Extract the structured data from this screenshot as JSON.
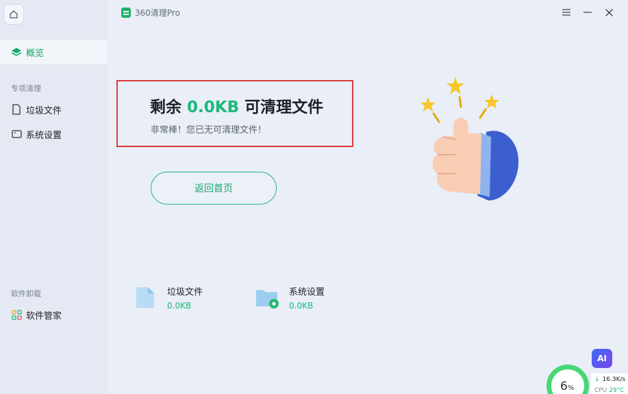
{
  "app": {
    "title": "360清理Pro"
  },
  "sidebar": {
    "overview": "概览",
    "section_special": "专项清理",
    "items": [
      {
        "label": "垃圾文件"
      },
      {
        "label": "系统设置"
      }
    ],
    "section_uninstall": "软件卸载",
    "software_manager": "软件管家"
  },
  "result": {
    "prefix": "剩余",
    "amount": "0.0KB",
    "suffix": "可清理文件",
    "subtitle": "非常棒！您已无可清理文件！",
    "back_button": "返回首页"
  },
  "summary": [
    {
      "name": "垃圾文件",
      "size": "0.0KB"
    },
    {
      "name": "系统设置",
      "size": "0.0KB"
    }
  ],
  "widget": {
    "ai_label": "AI",
    "percent": "6",
    "percent_unit": "%",
    "net_speed": "16.3K/s",
    "cpu_label": "CPU",
    "cpu_temp": "29°C"
  },
  "colors": {
    "accent": "#1ab97a",
    "highlight_border": "#d83b3b",
    "ai_badge": "#5a5af0"
  }
}
